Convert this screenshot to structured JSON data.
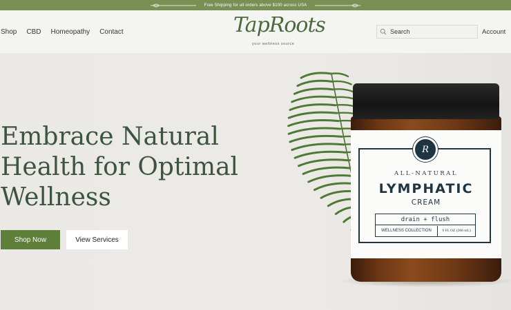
{
  "announcement": {
    "text": "Free Shipping for all orders above $100 across USA"
  },
  "nav": {
    "items": [
      "Shop",
      "CBD",
      "Homeopathy",
      "Contact"
    ]
  },
  "logo": {
    "name": "TapRoots",
    "tagline": "your wellness source"
  },
  "search": {
    "placeholder": "Search"
  },
  "account": {
    "label": "Account"
  },
  "hero": {
    "headline": "Embrace Natural Health for Optimal Wellness",
    "primary_button": "Shop Now",
    "secondary_button": "View Services"
  },
  "product": {
    "seal": "R",
    "line1": "ALL-NATURAL",
    "name": "LYMPHATIC",
    "type": "CREAM",
    "tagline": "drain + flush",
    "collection": "WELLNESS COLLECTION",
    "size": "9 FL OZ (266 mL)"
  },
  "colors": {
    "accent_green": "#5e7f3a",
    "announcement_bg": "#7a8f53",
    "headline": "#3c5440"
  }
}
